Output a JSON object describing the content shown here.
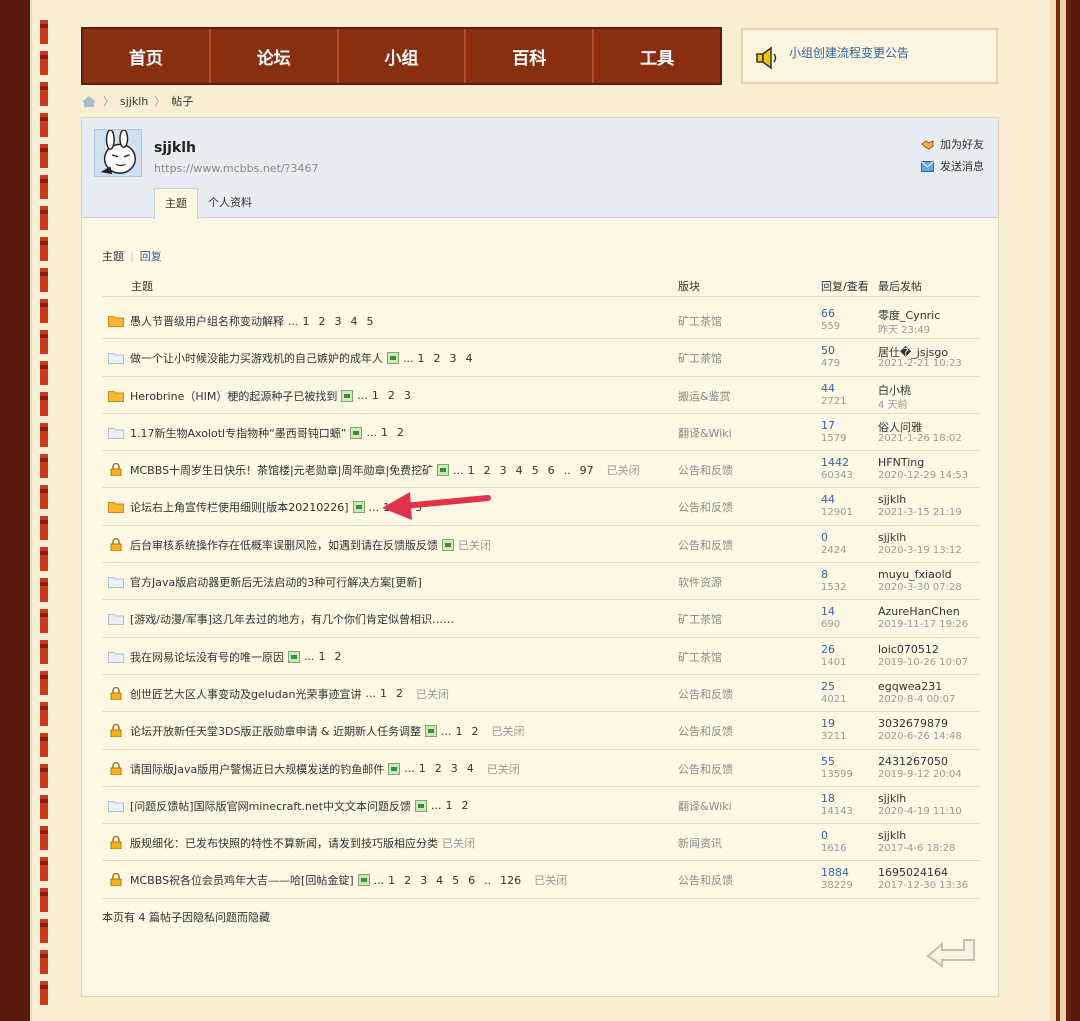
{
  "nav": {
    "items": [
      "首页",
      "论坛",
      "小组",
      "百科",
      "工具"
    ]
  },
  "notice": {
    "text": "小组创建流程变更公告",
    "icon": "speaker-icon"
  },
  "breadcrumb": {
    "user": "sjjklh",
    "page": "帖子"
  },
  "profile": {
    "name": "sjjklh",
    "url": "https://www.mcbbs.net/?3467",
    "tabs": [
      "主题",
      "个人资料"
    ],
    "actions": {
      "add_friend": "加为好友",
      "send_message": "发送消息"
    }
  },
  "subtabs": {
    "topics": "主题",
    "replies": "回复"
  },
  "table": {
    "headers": {
      "topic": "主题",
      "forum": "版块",
      "stats": "回复/查看",
      "last": "最后发帖"
    },
    "rows": [
      {
        "icon": "folder-new-icon",
        "title": "愚人节晋级用户组名称变动解释",
        "att": false,
        "dots": "...",
        "pages": [
          "1",
          "2",
          "3",
          "4",
          "5"
        ],
        "closed": "",
        "forum": "矿工茶馆",
        "replies": "66",
        "views": "559",
        "last_user": "零度_Cynric",
        "last_time": "昨天 23:49"
      },
      {
        "icon": "folder-icon",
        "title": "做一个让小时候没能力买游戏机的自己嫉妒的成年人",
        "att": true,
        "dots": "...",
        "pages": [
          "1",
          "2",
          "3",
          "4"
        ],
        "closed": "",
        "forum": "矿工茶馆",
        "replies": "50",
        "views": "479",
        "last_user": "居仕�_jsjsgo",
        "last_time": "2021-2-21 10:23"
      },
      {
        "icon": "folder-new-icon",
        "title": "Herobrine（HIM）梗的起源种子已被找到",
        "att": true,
        "dots": "...",
        "pages": [
          "1",
          "2",
          "3"
        ],
        "closed": "",
        "forum": "搬运&鉴赏",
        "replies": "44",
        "views": "2721",
        "last_user": "白小桃",
        "last_time": "4 天前"
      },
      {
        "icon": "folder-icon",
        "title": "1.17新生物Axolotl专指物种“墨西哥钝口螈”",
        "att": true,
        "dots": "...",
        "pages": [
          "1",
          "2"
        ],
        "closed": "",
        "forum": "翻译&Wiki",
        "replies": "17",
        "views": "1579",
        "last_user": "俗人问雅",
        "last_time": "2021-1-26 18:02"
      },
      {
        "icon": "lock-icon",
        "title": "MCBBS十周岁生日快乐！茶馆楼|元老勋章|周年勋章|免费挖矿",
        "att": true,
        "dots": "...",
        "pages": [
          "1",
          "2",
          "3",
          "4",
          "5",
          "6",
          "..",
          "97"
        ],
        "closed": "已关闭",
        "forum": "公告和反馈",
        "replies": "1442",
        "views": "60343",
        "last_user": "HFNTing",
        "last_time": "2020-12-29 14:53"
      },
      {
        "icon": "folder-new-icon",
        "title": "论坛右上角宣传栏使用细则[版本20210226]",
        "att": true,
        "dots": "...",
        "pages": [
          "1",
          "2",
          "3"
        ],
        "closed": "",
        "forum": "公告和反馈",
        "replies": "44",
        "views": "12901",
        "last_user": "sjjklh",
        "last_time": "2021-3-15 21:19"
      },
      {
        "icon": "lock-icon",
        "title": "后台审核系统操作存在低概率误删风险，如遇到请在反馈版反馈",
        "att": true,
        "dots": "",
        "pages": [],
        "closed": "已关闭",
        "forum": "公告和反馈",
        "replies": "0",
        "views": "2424",
        "last_user": "sjjklh",
        "last_time": "2020-3-19 13:12"
      },
      {
        "icon": "folder-icon",
        "title": "官方Java版启动器更新后无法启动的3种可行解决方案[更新]",
        "att": false,
        "dots": "",
        "pages": [],
        "closed": "",
        "forum": "软件资源",
        "replies": "8",
        "views": "1532",
        "last_user": "muyu_fxiaold",
        "last_time": "2020-3-30 07:28"
      },
      {
        "icon": "folder-icon",
        "title": "[游戏/动漫/军事]这几年去过的地方，有几个你们肯定似曾相识……",
        "att": false,
        "dots": "",
        "pages": [],
        "closed": "",
        "forum": "矿工茶馆",
        "replies": "14",
        "views": "690",
        "last_user": "AzureHanChen",
        "last_time": "2019-11-17 19:26"
      },
      {
        "icon": "folder-icon",
        "title": "我在网易论坛没有号的唯一原因",
        "att": true,
        "dots": "...",
        "pages": [
          "1",
          "2"
        ],
        "closed": "",
        "forum": "矿工茶馆",
        "replies": "26",
        "views": "1401",
        "last_user": "loic070512",
        "last_time": "2019-10-26 10:07"
      },
      {
        "icon": "lock-icon",
        "title": "创世匠艺大区人事变动及geludan光荣事迹宣讲",
        "att": false,
        "dots": "...",
        "pages": [
          "1",
          "2"
        ],
        "closed": "已关闭",
        "forum": "公告和反馈",
        "replies": "25",
        "views": "4021",
        "last_user": "egqwea231",
        "last_time": "2020-8-4 00:07"
      },
      {
        "icon": "lock-icon",
        "title": "论坛开放新任天堂3DS版正版勋章申请 & 近期新人任务调整",
        "att": true,
        "dots": "...",
        "pages": [
          "1",
          "2"
        ],
        "closed": "已关闭",
        "forum": "公告和反馈",
        "replies": "19",
        "views": "3211",
        "last_user": "3032679879",
        "last_time": "2020-6-26 14:48"
      },
      {
        "icon": "lock-icon",
        "title": "请国际版Java版用户警惕近日大规模发送的钓鱼邮件",
        "att": true,
        "dots": "...",
        "pages": [
          "1",
          "2",
          "3",
          "4"
        ],
        "closed": "已关闭",
        "forum": "公告和反馈",
        "replies": "55",
        "views": "13599",
        "last_user": "2431267050",
        "last_time": "2019-9-12 20:04"
      },
      {
        "icon": "folder-icon",
        "title": "[问题反馈帖]国际版官网minecraft.net中文文本问题反馈",
        "att": true,
        "dots": "...",
        "pages": [
          "1",
          "2"
        ],
        "closed": "",
        "forum": "翻译&Wiki",
        "replies": "18",
        "views": "14143",
        "last_user": "sjjklh",
        "last_time": "2020-4-19 11:10"
      },
      {
        "icon": "lock-icon",
        "title": "版规细化：已发布快照的特性不算新闻，请发到技巧版相应分类",
        "att": false,
        "dots": "",
        "pages": [],
        "closed": "已关闭",
        "forum": "新闻资讯",
        "replies": "0",
        "views": "1616",
        "last_user": "sjjklh",
        "last_time": "2017-4-6 18:28"
      },
      {
        "icon": "lock-icon",
        "title": "MCBBS祝各位会员鸡年大吉——哈[回帖金锭]",
        "att": true,
        "dots": "...",
        "pages": [
          "1",
          "2",
          "3",
          "4",
          "5",
          "6",
          "..",
          "126"
        ],
        "closed": "已关闭",
        "forum": "公告和反馈",
        "replies": "1884",
        "views": "38229",
        "last_user": "1695024164",
        "last_time": "2017-12-30 13:36"
      }
    ]
  },
  "footnote": "本页有 4 篇帖子因隐私问题而隐藏",
  "colors": {
    "nav_bg": "#8a2e12",
    "link": "#336699",
    "page_bg": "#f7eed3",
    "arrow": "#e0334a"
  }
}
